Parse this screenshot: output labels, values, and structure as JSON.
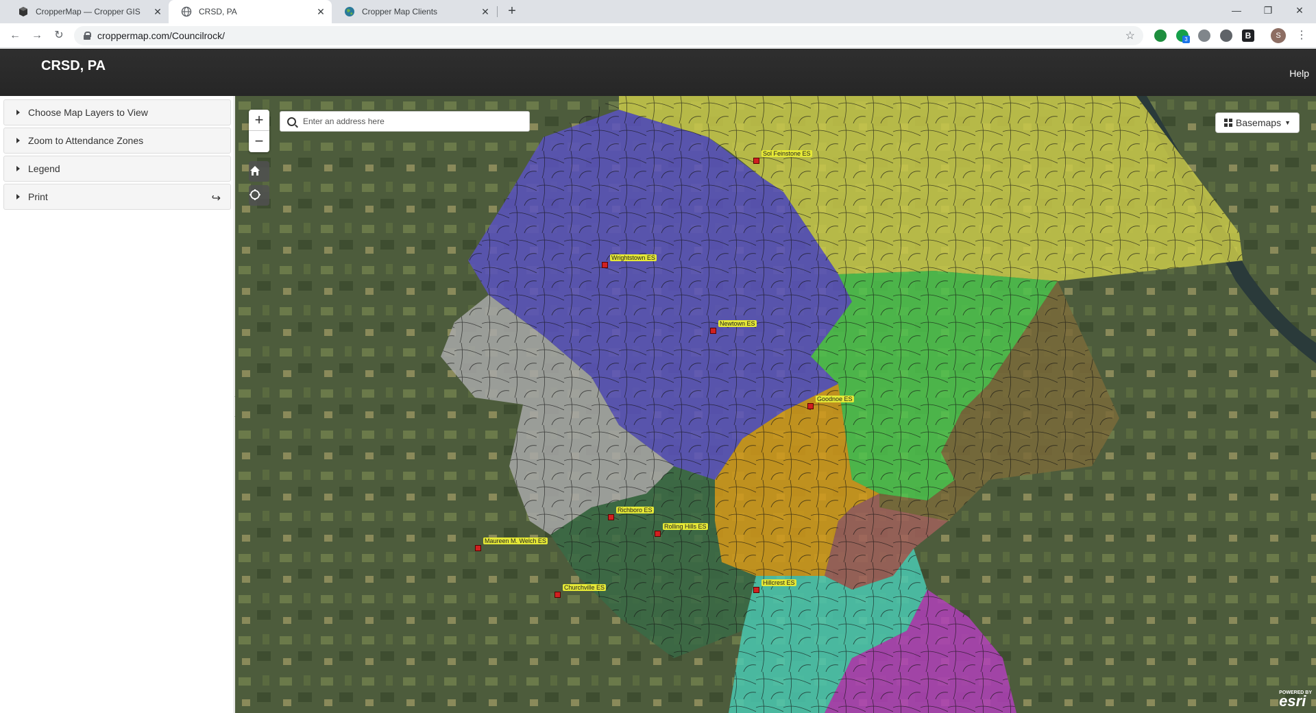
{
  "browser": {
    "tabs": [
      {
        "title": "CropperMap — Cropper GIS",
        "active": false,
        "icon": "cube-icon"
      },
      {
        "title": "CRSD, PA",
        "active": true,
        "icon": "globe-icon"
      },
      {
        "title": "Cropper Map Clients",
        "active": false,
        "icon": "earth-icon"
      }
    ],
    "url": "croppermap.com/Councilrock/",
    "profile_initial": "S",
    "extension_badge": "3"
  },
  "app": {
    "title": "CRSD, PA",
    "help_label": "Help"
  },
  "sidebar": {
    "panels": [
      {
        "label": "Choose Map Layers to View"
      },
      {
        "label": "Zoom to Attendance Zones"
      },
      {
        "label": "Legend"
      },
      {
        "label": "Print"
      }
    ]
  },
  "map": {
    "search_placeholder": "Enter an address here",
    "basemaps_label": "Basemaps",
    "attribution": "esri",
    "attribution_prefix": "POWERED BY",
    "schools": [
      "Sol Feinstone ES",
      "Wrightstown ES",
      "Newtown ES",
      "Goodnoe ES",
      "Richboro ES",
      "Rolling Hills ES",
      "Maureen M. Welch ES",
      "Churchville ES",
      "Hillcrest ES"
    ],
    "zone_colors": {
      "sol_feinstone": "#c9c94a",
      "wrightstown": "#5a52c0",
      "newtown": "#4cc34c",
      "goodnoe": "#7a6a3a",
      "richboro": "#d49a1a",
      "rolling_hills": "#a0605a",
      "welch": "#a8a8a8",
      "churchville": "#3a6a45",
      "hillcrest": "#4ac8b0",
      "south": "#b040b8"
    }
  }
}
